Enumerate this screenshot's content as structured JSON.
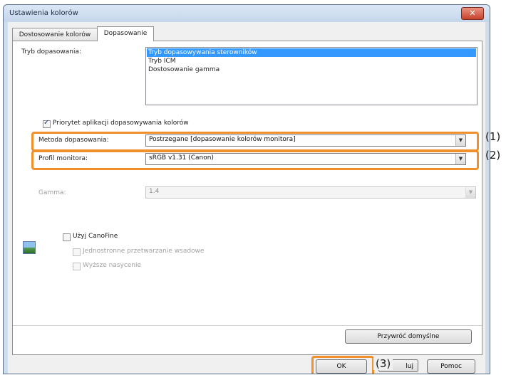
{
  "window": {
    "title": "Ustawienia kolorów",
    "close_glyph": "✕"
  },
  "tabs": [
    {
      "label": "Dostosowanie kolorów",
      "active": false
    },
    {
      "label": "Dopasowanie",
      "active": true
    }
  ],
  "matching_mode": {
    "label": "Tryb dopasowania:",
    "options": [
      {
        "label": "Tryb dopasowywania sterowników",
        "selected": true
      },
      {
        "label": "Tryb ICM",
        "selected": false
      },
      {
        "label": "Dostosowanie gamma",
        "selected": false
      }
    ]
  },
  "priority_checkbox": {
    "label": "Priorytet aplikacji dopasowywania kolorów",
    "checked": true
  },
  "matching_method": {
    "label": "Metoda dopasowania:",
    "value": "Postrzegane [dopasowanie kolorów monitora]"
  },
  "monitor_profile": {
    "label": "Profil monitora:",
    "value": "sRGB v1.31 (Canon)"
  },
  "gamma": {
    "label": "Gamma:",
    "value": "1.4",
    "enabled": false
  },
  "canofine": {
    "label": "Użyj CanoFine",
    "checked": false,
    "sub_options": [
      {
        "label": "Jednostronne przetwarzanie wsadowe",
        "checked": false,
        "enabled": false
      },
      {
        "label": "Wyższe nasycenie",
        "checked": false,
        "enabled": false
      }
    ]
  },
  "buttons": {
    "restore_defaults": "Przywróć domyślne",
    "ok": "OK",
    "cancel_partial": "luj",
    "help": "Pomoc"
  },
  "annotations": {
    "one": "(1)",
    "two": "(2)",
    "three": "(3)"
  },
  "colors": {
    "highlight": "#f0902a",
    "selection": "#3399ff"
  },
  "icons": {
    "dropdown": "chevron-down-icon",
    "image": "picture-icon"
  }
}
